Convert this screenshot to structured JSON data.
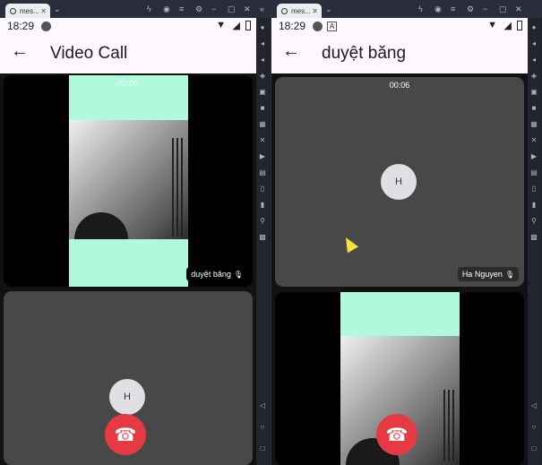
{
  "windows": [
    {
      "tab_title": "mes...",
      "phone": {
        "status_time": "18:29",
        "app_title": "Video Call",
        "top_tile": {
          "timer": "00:00",
          "name": "duyệt băng"
        },
        "bottom_tile": {
          "avatar_letter": "H"
        }
      }
    },
    {
      "tab_title": "mes...",
      "phone": {
        "status_time": "18:29",
        "app_title": "duyệt băng",
        "top_tile": {
          "timer": "00:06",
          "avatar_letter": "H",
          "name": "Ha Nguyen"
        }
      }
    }
  ],
  "colors": {
    "hangup": "#e53a44",
    "camera_bg": "#b1f9dd",
    "appbar": "#fdf7fe"
  },
  "icons": [
    "back-arrow-icon",
    "phone-hangup-icon",
    "mic-icon",
    "wifi-icon",
    "signal-icon",
    "battery-icon"
  ]
}
